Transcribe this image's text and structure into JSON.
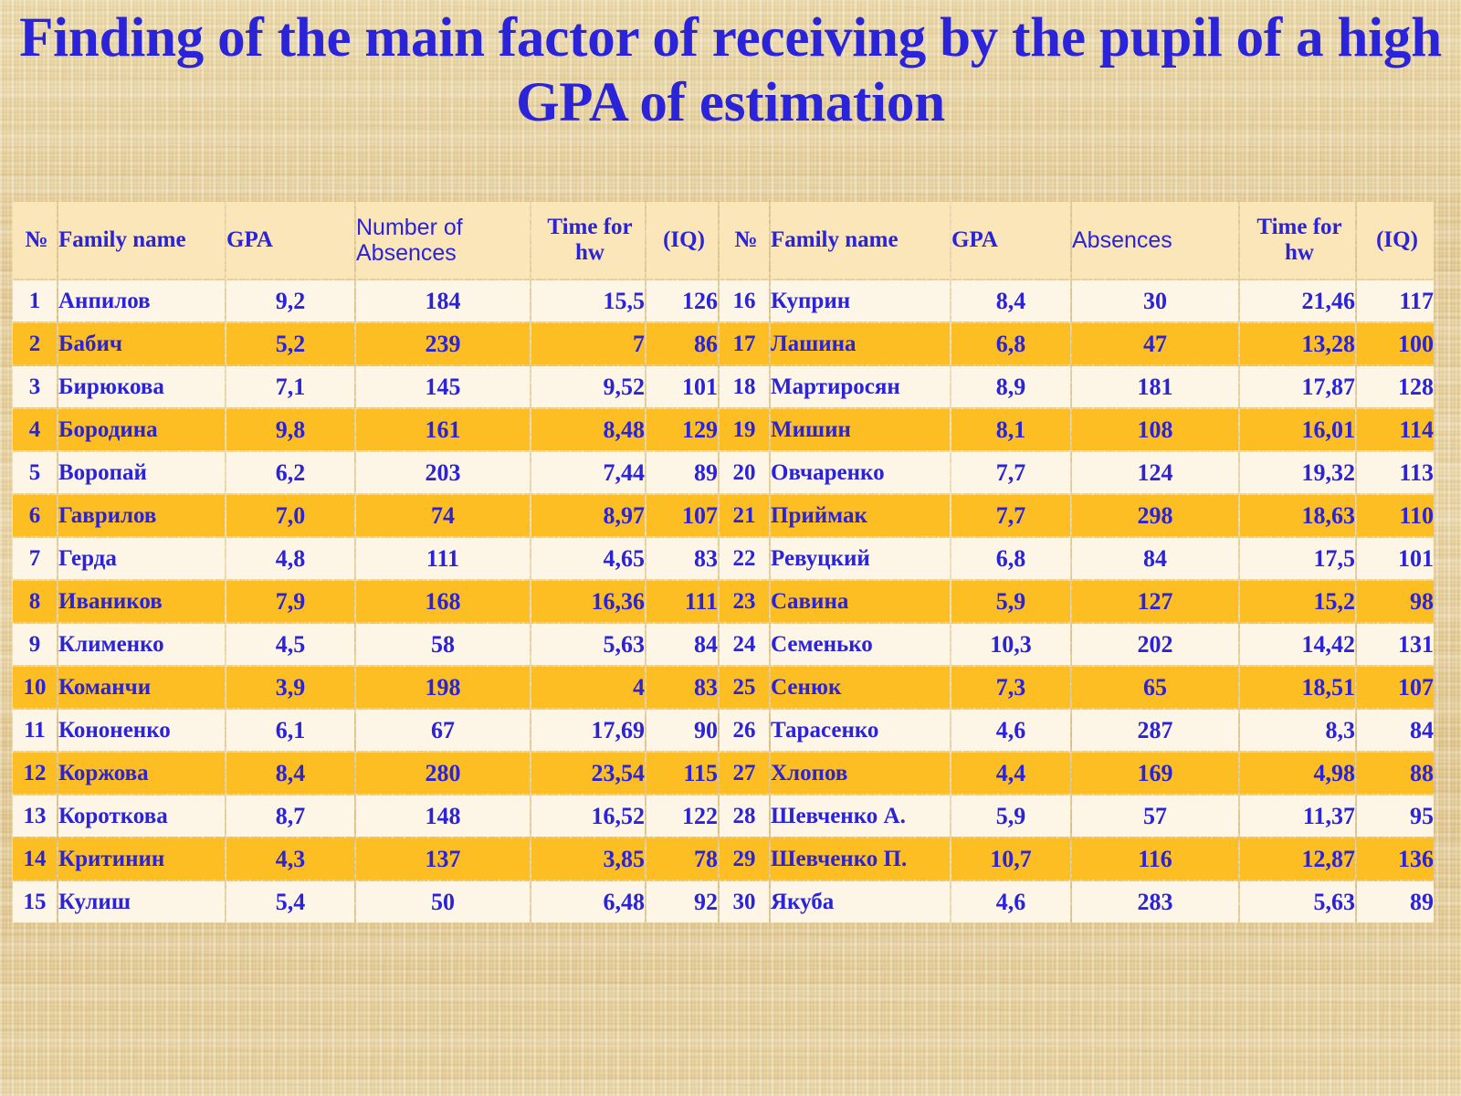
{
  "slide": {
    "title": "Finding of the main factor of receiving by the pupil of a high GPA of estimation",
    "title_color": "#2a23d8",
    "background_color": "#e4cb90",
    "row_light_color": "#fdf6e6",
    "row_dark_color": "#fcbe22",
    "header_color": "#fae6b8"
  },
  "table": {
    "left_headers": {
      "no": "№",
      "family_name": "Family name",
      "gpa": "GPA",
      "absences": "Number of Absences",
      "time": "Time for hw",
      "iq": "(IQ)"
    },
    "right_headers": {
      "no": "№",
      "family_name": "Family name",
      "gpa": "GPA",
      "absences": "Absences",
      "time": "Time for hw",
      "iq": "(IQ)"
    },
    "left_rows": [
      {
        "no": "1",
        "name": "Анпилов",
        "gpa": "9,2",
        "absences": "184",
        "time": "15,5",
        "iq": "126"
      },
      {
        "no": "2",
        "name": "Бабич",
        "gpa": "5,2",
        "absences": "239",
        "time": "7",
        "iq": "86"
      },
      {
        "no": "3",
        "name": "Бирюкова",
        "gpa": "7,1",
        "absences": "145",
        "time": "9,52",
        "iq": "101"
      },
      {
        "no": "4",
        "name": "Бородина",
        "gpa": "9,8",
        "absences": "161",
        "time": "8,48",
        "iq": "129"
      },
      {
        "no": "5",
        "name": "Воропай",
        "gpa": "6,2",
        "absences": "203",
        "time": "7,44",
        "iq": "89"
      },
      {
        "no": "6",
        "name": "Гаврилов",
        "gpa": "7,0",
        "absences": "74",
        "time": "8,97",
        "iq": "107"
      },
      {
        "no": "7",
        "name": "Герда",
        "gpa": "4,8",
        "absences": "111",
        "time": "4,65",
        "iq": "83"
      },
      {
        "no": "8",
        "name": "Иваников",
        "gpa": "7,9",
        "absences": "168",
        "time": "16,36",
        "iq": "111"
      },
      {
        "no": "9",
        "name": "Клименко",
        "gpa": "4,5",
        "absences": "58",
        "time": "5,63",
        "iq": "84"
      },
      {
        "no": "10",
        "name": "Команчи",
        "gpa": "3,9",
        "absences": "198",
        "time": "4",
        "iq": "83"
      },
      {
        "no": "11",
        "name": "Кононенко",
        "gpa": "6,1",
        "absences": "67",
        "time": "17,69",
        "iq": "90"
      },
      {
        "no": "12",
        "name": "Коржова",
        "gpa": "8,4",
        "absences": "280",
        "time": "23,54",
        "iq": "115"
      },
      {
        "no": "13",
        "name": "Короткова",
        "gpa": "8,7",
        "absences": "148",
        "time": "16,52",
        "iq": "122"
      },
      {
        "no": "14",
        "name": "Критинин",
        "gpa": "4,3",
        "absences": "137",
        "time": "3,85",
        "iq": "78"
      },
      {
        "no": "15",
        "name": "Кулиш",
        "gpa": "5,4",
        "absences": "50",
        "time": "6,48",
        "iq": "92"
      }
    ],
    "right_rows": [
      {
        "no": "16",
        "name": "Куприн",
        "gpa": "8,4",
        "absences": "30",
        "time": "21,46",
        "iq": "117"
      },
      {
        "no": "17",
        "name": "Лашина",
        "gpa": "6,8",
        "absences": "47",
        "time": "13,28",
        "iq": "100"
      },
      {
        "no": "18",
        "name": "Мартиросян",
        "gpa": "8,9",
        "absences": "181",
        "time": "17,87",
        "iq": "128"
      },
      {
        "no": "19",
        "name": "Мишин",
        "gpa": "8,1",
        "absences": "108",
        "time": "16,01",
        "iq": "114"
      },
      {
        "no": "20",
        "name": "Овчаренко",
        "gpa": "7,7",
        "absences": "124",
        "time": "19,32",
        "iq": "113"
      },
      {
        "no": "21",
        "name": "Приймак",
        "gpa": "7,7",
        "absences": "298",
        "time": "18,63",
        "iq": "110"
      },
      {
        "no": "22",
        "name": "Ревуцкий",
        "gpa": "6,8",
        "absences": "84",
        "time": "17,5",
        "iq": "101"
      },
      {
        "no": "23",
        "name": "Савина",
        "gpa": "5,9",
        "absences": "127",
        "time": "15,2",
        "iq": "98"
      },
      {
        "no": "24",
        "name": "Семенько",
        "gpa": "10,3",
        "absences": "202",
        "time": "14,42",
        "iq": "131"
      },
      {
        "no": "25",
        "name": "Сенюк",
        "gpa": "7,3",
        "absences": "65",
        "time": "18,51",
        "iq": "107"
      },
      {
        "no": "26",
        "name": "Тарасенко",
        "gpa": "4,6",
        "absences": "287",
        "time": "8,3",
        "iq": "84"
      },
      {
        "no": "27",
        "name": "Хлопов",
        "gpa": "4,4",
        "absences": "169",
        "time": "4,98",
        "iq": "88"
      },
      {
        "no": "28",
        "name": "Шевченко А.",
        "gpa": "5,9",
        "absences": "57",
        "time": "11,37",
        "iq": "95"
      },
      {
        "no": "29",
        "name": "Шевченко П.",
        "gpa": "10,7",
        "absences": "116",
        "time": "12,87",
        "iq": "136"
      },
      {
        "no": "30",
        "name": "Якуба",
        "gpa": "4,6",
        "absences": "283",
        "time": "5,63",
        "iq": "89"
      }
    ]
  }
}
